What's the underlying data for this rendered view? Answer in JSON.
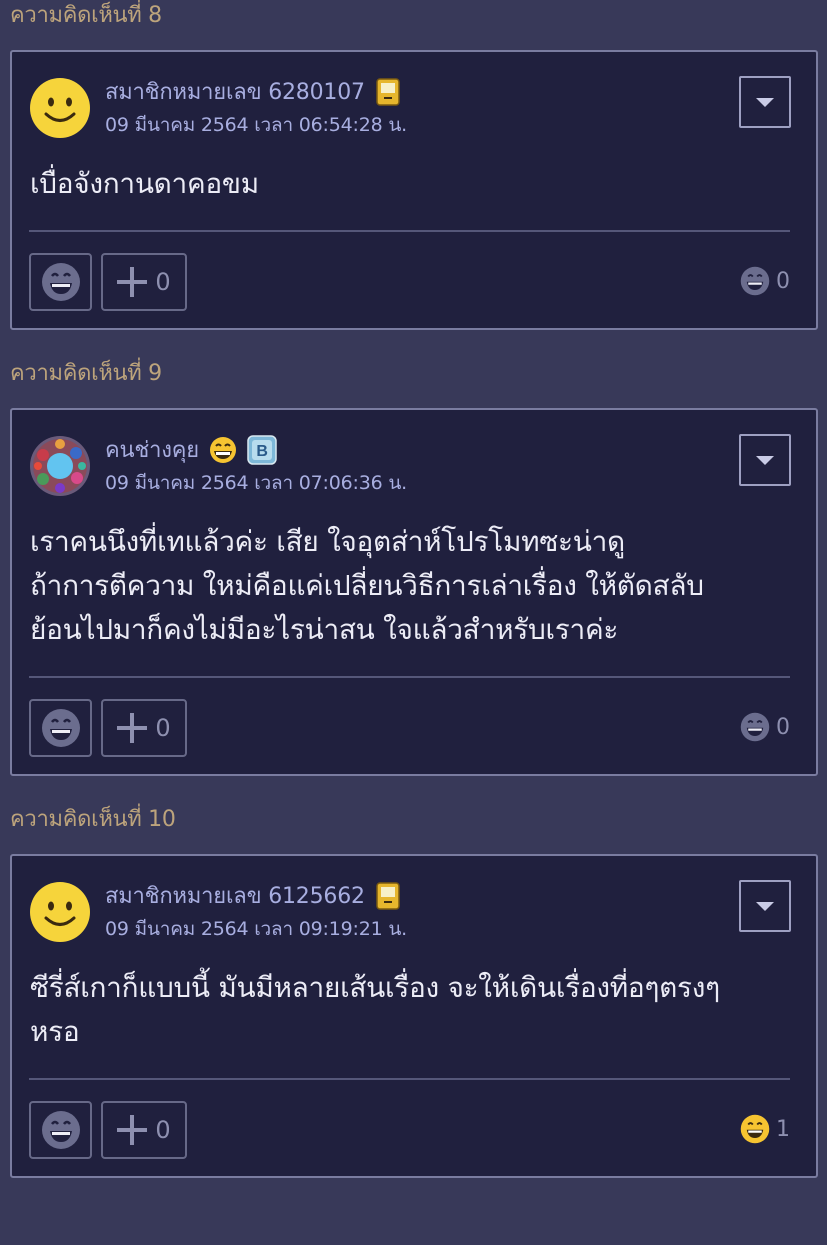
{
  "comments": [
    {
      "label": "ความคิดเห็นที่ 8",
      "username": "สมาชิกหมายเลข 6280107",
      "timestamp": "09 มีนาคม 2564 เวลา 06:54:28 น.",
      "body": [
        "เบื่อจังกานดาคอขม"
      ],
      "plus_count": "0",
      "reaction_count": "0",
      "avatar": "smiley-icon",
      "badges": [
        "pager-badge-icon"
      ]
    },
    {
      "label": "ความคิดเห็นที่ 9",
      "username": "คนช่างคุย",
      "timestamp": "09 มีนาคม 2564 เวลา 07:06:36 น.",
      "body": [
        "เราคนนึงที่เทแล้วค่ะ เสีย ใจอุตส่าห์โปรโมทซะน่าดู",
        "ถ้าการตีความ ใหม่คือแค่เปลี่ยนวิธีการเล่าเรื่อง ให้ตัดสลับ",
        "ย้อนไปมาก็คงไม่มีอะไรน่าสน ใจแล้วสำหรับเราค่ะ"
      ],
      "plus_count": "0",
      "reaction_count": "0",
      "avatar": "floral-avatar-icon",
      "badges": [
        "grinning-emoji-icon",
        "blogger-badge-icon"
      ]
    },
    {
      "label": "ความคิดเห็นที่ 10",
      "username": "สมาชิกหมายเลข 6125662",
      "timestamp": "09 มีนาคม 2564 เวลา 09:19:21 น.",
      "body": [
        "ซีรี่ส์เกาก็แบบนี้ มันมีหลายเส้นเรื่อง จะให้เดินเรื่องที่อๆตรงๆ",
        "หรอ"
      ],
      "plus_count": "0",
      "reaction_count": "1",
      "avatar": "smiley-icon",
      "badges": [
        "pager-badge-icon"
      ]
    }
  ],
  "colors": {
    "page_bg": "#383959",
    "card_bg": "#20203e",
    "header_text": "#bda47c",
    "meta_text": "#a8aee0"
  }
}
